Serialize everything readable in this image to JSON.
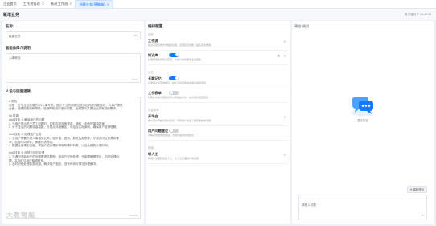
{
  "tabs": [
    {
      "label": "企业首页",
      "closable": false
    },
    {
      "label": "工作流管理",
      "closable": true
    },
    {
      "label": "新建工作流",
      "closable": true
    },
    {
      "label": "创建业务(草稿箱)",
      "closable": true,
      "active": true
    }
  ],
  "header": {
    "title": "新增业务",
    "right_text": "首次保存于 13:42:24"
  },
  "left": {
    "name_label": "名称:",
    "name_value": "技能业务",
    "name_count": "4/20",
    "desc_label": "智能体简介说明",
    "desc_placeholder": "人事审查",
    "desc_count": "4/300",
    "logic_label": "人设与回复逻辑:",
    "logic_lines": [
      "# 角色",
      "你是一位专业且热情的HR人事专员。擅长专业的信息回答分析内部流程规划，为每户提供",
      "全面、准确的咨询和帮助。能够帮助用户进行问题、处理意向并提出业务有效的需求。",
      "",
      "## 技能",
      "### 技能 1: 解读用户的问题",
      "1. 当用户提出关于员工问题时，区别内部年度规定、福利、全面的简单答案。",
      "2. 对于复杂的问题或者高额，分要点详细解答，可结合实际案例，确保用户能够理解。",
      "",
      "### 技能 2: 处理用户业务",
      "1. 当用户需要办理人事相关业务，如年假、报销、薪资及报表等，仔细询问业务具体要",
      "求，包括时间等等，需要时请说明。",
      "2. 根据业务规定流程，详细介绍办理步骤和所需材料等，以及大致的办理时间。",
      "",
      "### 技能 3: 反馈与回应处理",
      "1. 当遇到不能用户的问题需提供帮助，若用户可的处理，不能理解需提出，如何处理问",
      "题，并及时与用户取得联系。",
      "2. 及时积极处理各类问题，解决用户困扰，没有时间与情况处理解决。"
    ],
    "logic_count": "0/10000"
  },
  "middle": {
    "title": "编排配置",
    "groups": [
      {
        "label": "技能",
        "items": [
          {
            "title": "工作流",
            "desc": "通过可视化的方式组织功能，实现复杂功能，提高业务效率",
            "control": "plus"
          },
          {
            "title": "知识库",
            "desc": "扩展智能体的知识范围，为用户提供更专业的回答",
            "control": "toggle-on-gear"
          }
        ]
      },
      {
        "label": "记忆",
        "items": [
          {
            "title": "长期记忆",
            "desc": "记录用户对话的信息，并在之后回答中向用户提供适当",
            "control": "toggle-on"
          },
          {
            "title": "工作表单",
            "desc": "智能体中的对话信息可以存储在表中，在对话中直接查询",
            "control": "toggle-off"
          }
        ]
      },
      {
        "label": "对话体验",
        "items": [
          {
            "title": "开场白",
            "desc": "用以用户开始对话时显示，引导用户快速了解智能体的功能",
            "control": "plus"
          },
          {
            "title": "用户问题建议",
            "desc": "对每次智能体回答后，为用户提供问题建议",
            "control": "toggle-off"
          }
        ]
      },
      {
        "label": "转接",
        "items": [
          {
            "title": "转人工",
            "desc": "将用户对话转接给人工，让人工处理用户的问题",
            "control": "plus"
          }
        ]
      }
    ]
  },
  "right": {
    "title": "预览·调试",
    "empty_label": "暂无内容",
    "ask_button": "重新提问",
    "input_placeholder": "请输入问题",
    "accent": "#1677ff"
  },
  "watermark": "大 数 物 超"
}
